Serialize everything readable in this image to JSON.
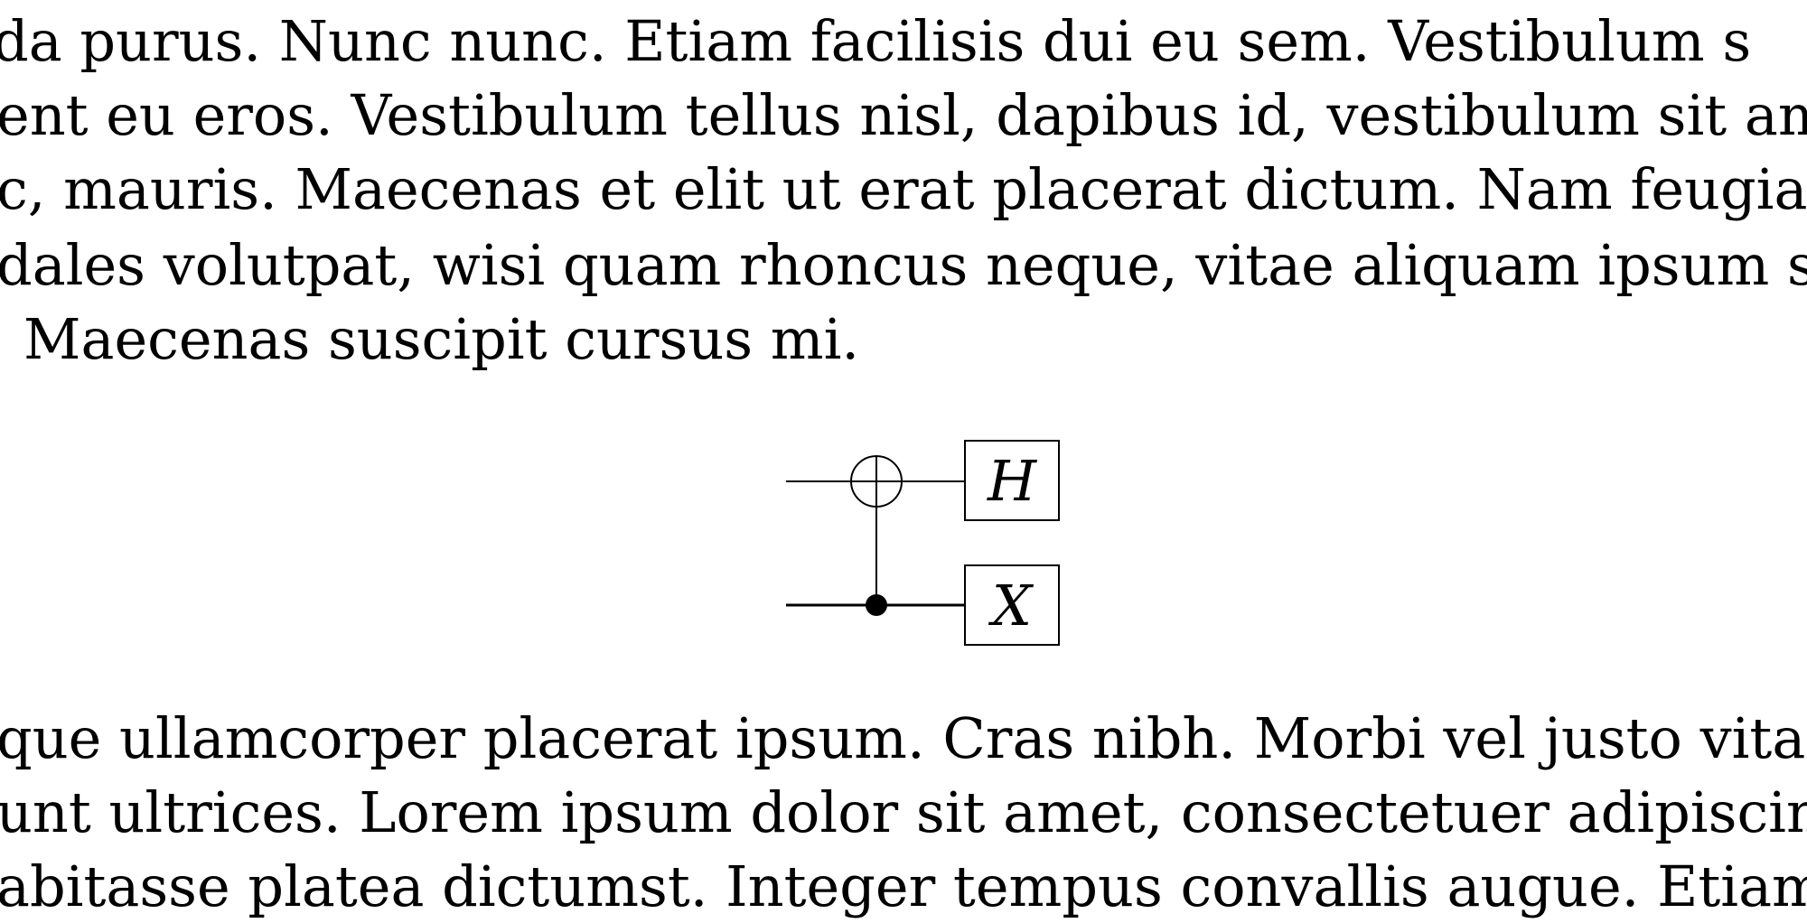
{
  "text_top": [
    "da purus.  Nunc nunc.  Etiam facilisis dui eu sem.  Vestibulum s",
    "ent eu eros. Vestibulum tellus nisl, dapibus id, vestibulum sit ame",
    "c, mauris. Maecenas et elit ut erat placerat dictum. Nam feugiat",
    "dales volutpat, wisi quam rhoncus neque, vitae aliquam ipsum sap",
    "Maecenas suscipit cursus mi."
  ],
  "circuit": {
    "gates": {
      "top": "H",
      "bottom": "X"
    }
  },
  "text_bottom": [
    "que ullamcorper placerat ipsum.  Cras nibh.  Morbi vel justo vita",
    "unt ultrices. Lorem ipsum dolor sit amet, consectetuer adipiscing",
    "abitasse platea dictumst. Integer tempus convallis augue. Etiam f"
  ]
}
